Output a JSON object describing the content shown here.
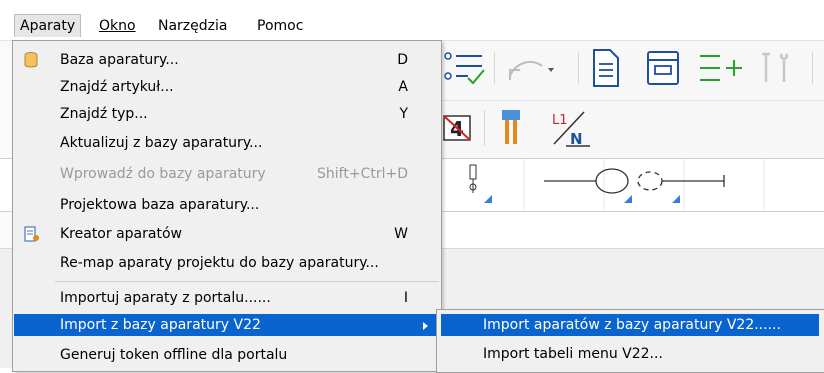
{
  "menubar": {
    "items": [
      {
        "label": "Aparaty"
      },
      {
        "label": "Okno"
      },
      {
        "label": "Narzędzia"
      },
      {
        "label": "Pomoc"
      }
    ]
  },
  "menu": {
    "items": [
      {
        "label": "Baza aparatury...",
        "shortcut": "D",
        "icon": "database-icon"
      },
      {
        "label": "Znajdź artykuł...",
        "shortcut": "A"
      },
      {
        "label": "Znajdź typ...",
        "shortcut": "Y"
      },
      {
        "label": "Aktualizuj z bazy aparatury..."
      },
      {
        "label": "Wprowadź do bazy aparatury",
        "shortcut": "Shift+Ctrl+D",
        "disabled": true
      },
      {
        "label": "Projektowa baza aparatury..."
      },
      {
        "label": "Kreator aparatów",
        "shortcut": "W",
        "icon": "wizard-icon"
      },
      {
        "label": "Re-map aparaty projektu do bazy aparatury..."
      },
      {
        "label": "Importuj aparaty z portalu......",
        "shortcut": "I"
      },
      {
        "label": "Import z bazy aparatury V22",
        "has_submenu": true,
        "highlighted": true
      },
      {
        "label": "Generuj token offline dla portalu"
      }
    ]
  },
  "submenu": {
    "items": [
      {
        "label": "Import aparatów z bazy aparatury V22......",
        "highlighted": true
      },
      {
        "label": "Import tabeli menu V22..."
      }
    ]
  },
  "toolbar": {
    "row2_label": "L1\nN"
  },
  "colors": {
    "highlight": "#0a64d0",
    "menu_bg": "#f0f0f0",
    "icon_blue": "#1f4fa0",
    "icon_green": "#2aa12a"
  }
}
